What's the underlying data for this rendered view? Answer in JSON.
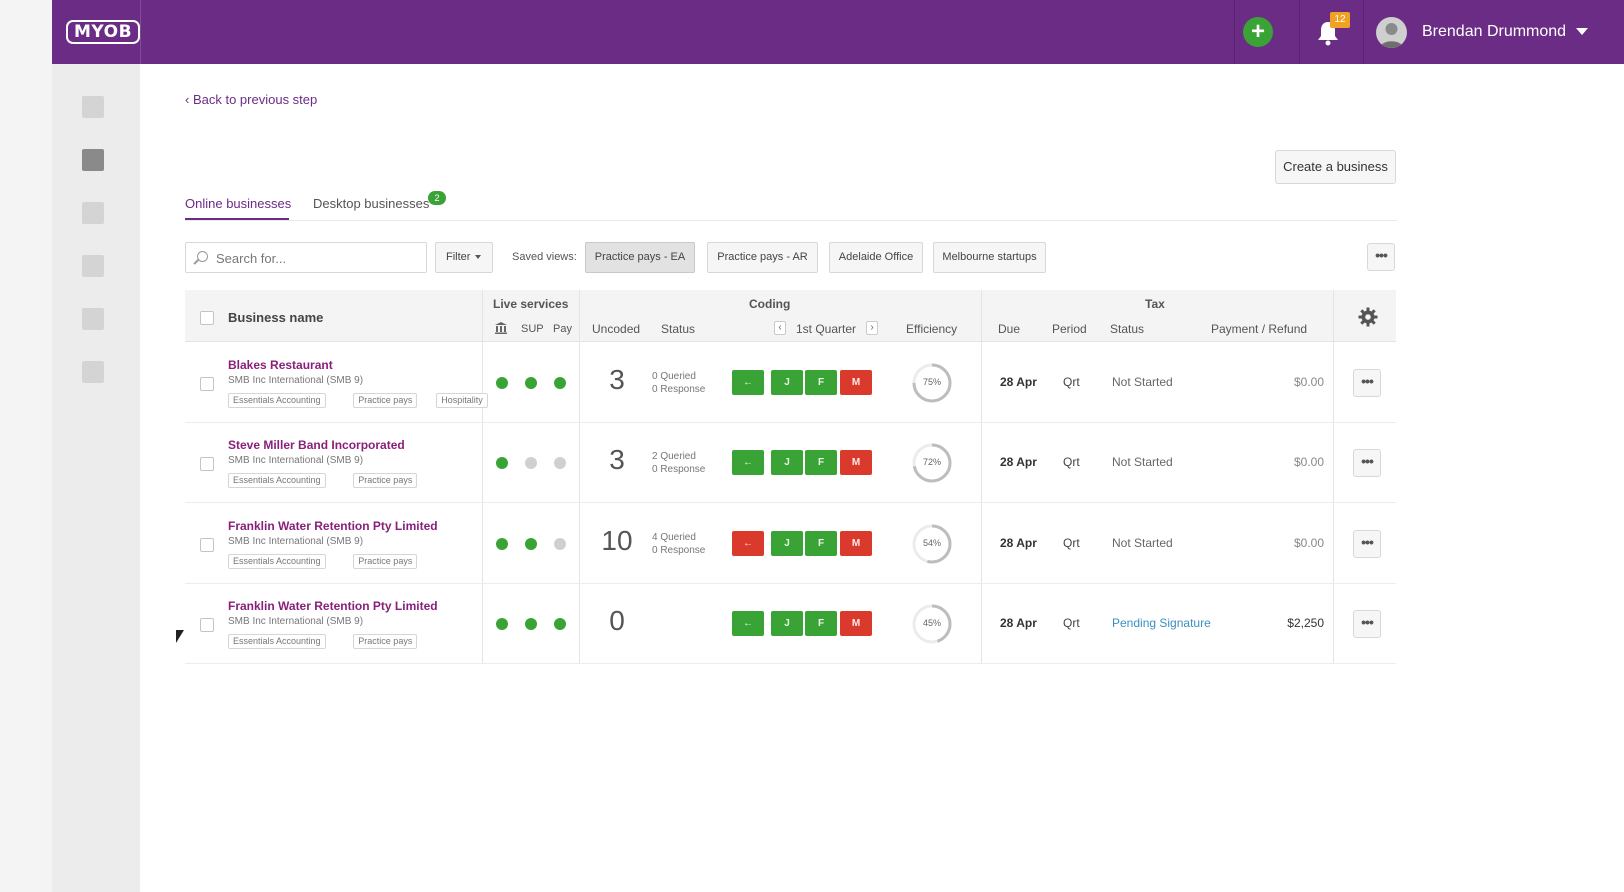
{
  "topbar": {
    "logo": "MYOB",
    "add_icon": "plus-icon",
    "notification_count": "12",
    "user_name": "Brendan Drummond"
  },
  "sidebar": {
    "items": [
      "nav-item-1",
      "nav-item-2",
      "nav-item-3",
      "nav-item-4",
      "nav-item-5",
      "nav-item-6"
    ],
    "active_index": 1
  },
  "page": {
    "back_link": "Back to previous step",
    "create_button": "Create a business"
  },
  "tabs": [
    {
      "label": "Online businesses",
      "active": true
    },
    {
      "label": "Desktop businesses",
      "badge": "2"
    }
  ],
  "toolbar": {
    "search_placeholder": "Search for...",
    "filter_label": "Filter",
    "saved_views_label": "Saved views:",
    "views": [
      "Practice pays - EA",
      "Practice pays - AR",
      "Adelaide Office",
      "Melbourne startups"
    ],
    "active_view": 0,
    "more_label": "•••"
  },
  "table": {
    "headers": {
      "business_name": "Business name",
      "live_services": "Live services",
      "sup": "SUP",
      "pay": "Pay",
      "coding": "Coding",
      "uncoded": "Uncoded",
      "status": "Status",
      "quarter": "1st Quarter",
      "efficiency": "Efficiency",
      "tax": "Tax",
      "due": "Due",
      "period": "Period",
      "tax_status": "Status",
      "payment": "Payment / Refund"
    },
    "rows": [
      {
        "name": "Blakes Restaurant",
        "sub": "SMB Inc International (SMB 9)",
        "tags": [
          "Essentials Accounting",
          "Practice pays",
          "Hospitality"
        ],
        "live": [
          "on",
          "on",
          "on"
        ],
        "uncoded": "3",
        "queried": "0 Queried",
        "response": "0 Response",
        "month_buttons": [
          {
            "label": "←",
            "state": "green"
          },
          {
            "label": "J",
            "state": "green"
          },
          {
            "label": "F",
            "state": "green"
          },
          {
            "label": "M",
            "state": "red"
          }
        ],
        "efficiency": 75,
        "efficiency_label": "75%",
        "due": "28 Apr",
        "period": "Qrt",
        "tax_status": "Not Started",
        "payment": "$0.00"
      },
      {
        "name": "Steve Miller Band Incorporated",
        "sub": "SMB Inc International (SMB 9)",
        "tags": [
          "Essentials Accounting",
          "Practice pays"
        ],
        "live": [
          "on",
          "off",
          "off"
        ],
        "uncoded": "3",
        "queried": "2 Queried",
        "response": "0 Response",
        "month_buttons": [
          {
            "label": "←",
            "state": "green"
          },
          {
            "label": "J",
            "state": "green"
          },
          {
            "label": "F",
            "state": "green"
          },
          {
            "label": "M",
            "state": "red"
          }
        ],
        "efficiency": 72,
        "efficiency_label": "72%",
        "due": "28 Apr",
        "period": "Qrt",
        "tax_status": "Not Started",
        "payment": "$0.00"
      },
      {
        "name": "Franklin Water Retention Pty Limited",
        "sub": "SMB Inc International (SMB 9)",
        "tags": [
          "Essentials Accounting",
          "Practice pays"
        ],
        "live": [
          "on",
          "on",
          "off"
        ],
        "uncoded": "10",
        "queried": "4 Queried",
        "response": "0 Response",
        "month_buttons": [
          {
            "label": "←",
            "state": "red"
          },
          {
            "label": "J",
            "state": "green"
          },
          {
            "label": "F",
            "state": "green"
          },
          {
            "label": "M",
            "state": "red"
          }
        ],
        "efficiency": 54,
        "efficiency_label": "54%",
        "due": "28 Apr",
        "period": "Qrt",
        "tax_status": "Not Started",
        "payment": "$0.00"
      },
      {
        "name": "Franklin Water Retention Pty Limited",
        "sub": "SMB Inc International (SMB 9)",
        "tags": [
          "Essentials Accounting",
          "Practice pays"
        ],
        "live": [
          "on",
          "on",
          "on"
        ],
        "uncoded": "0",
        "queried": "",
        "response": "",
        "month_buttons": [
          {
            "label": "←",
            "state": "green"
          },
          {
            "label": "J",
            "state": "green"
          },
          {
            "label": "F",
            "state": "green"
          },
          {
            "label": "M",
            "state": "red"
          }
        ],
        "efficiency": 45,
        "efficiency_label": "45%",
        "due": "28 Apr",
        "period": "Qrt",
        "tax_status": "Pending Signature",
        "payment": "$2,250"
      }
    ],
    "row_more_label": "•••"
  },
  "colors": {
    "brand": "#6b2c86",
    "name": "#8a1f7b",
    "green": "#3aa335",
    "red": "#d93a2b",
    "grey_dot": "#d0d0d0",
    "link_blue": "#3a8fc2"
  }
}
